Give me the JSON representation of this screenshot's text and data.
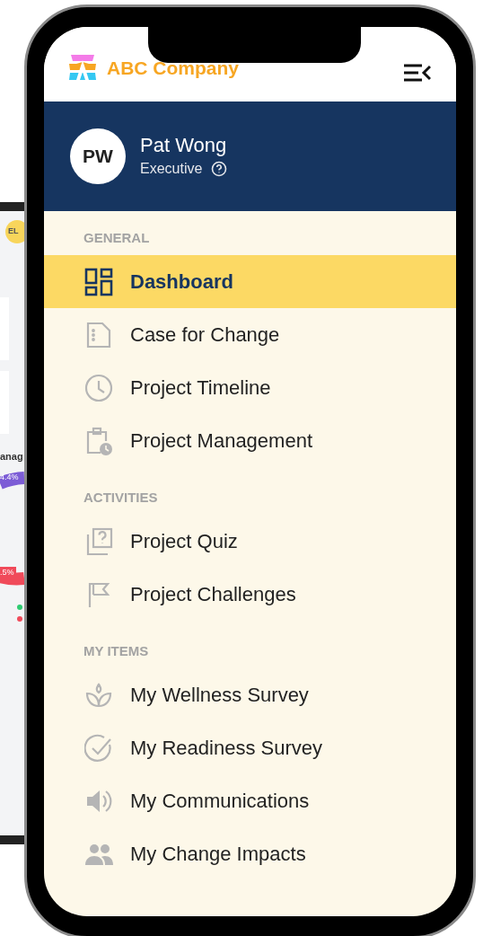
{
  "background_laptop": {
    "badge": "EL",
    "heading": "anag",
    "chart_labels": [
      "4.4%",
      ".5%"
    ]
  },
  "header": {
    "brand": "ABC Company"
  },
  "profile": {
    "initials": "PW",
    "name": "Pat Wong",
    "role": "Executive"
  },
  "sections": [
    {
      "title": "GENERAL",
      "items": [
        {
          "label": "Dashboard",
          "selected": true
        },
        {
          "label": "Case for Change",
          "selected": false
        },
        {
          "label": "Project Timeline",
          "selected": false
        },
        {
          "label": "Project Management",
          "selected": false
        }
      ]
    },
    {
      "title": "ACTIVITIES",
      "items": [
        {
          "label": "Project Quiz",
          "selected": false
        },
        {
          "label": "Project Challenges",
          "selected": false
        }
      ]
    },
    {
      "title": "MY ITEMS",
      "items": [
        {
          "label": "My Wellness Survey",
          "selected": false
        },
        {
          "label": "My Readiness Survey",
          "selected": false
        },
        {
          "label": "My Communications",
          "selected": false
        },
        {
          "label": "My Change Impacts",
          "selected": false
        }
      ]
    }
  ]
}
